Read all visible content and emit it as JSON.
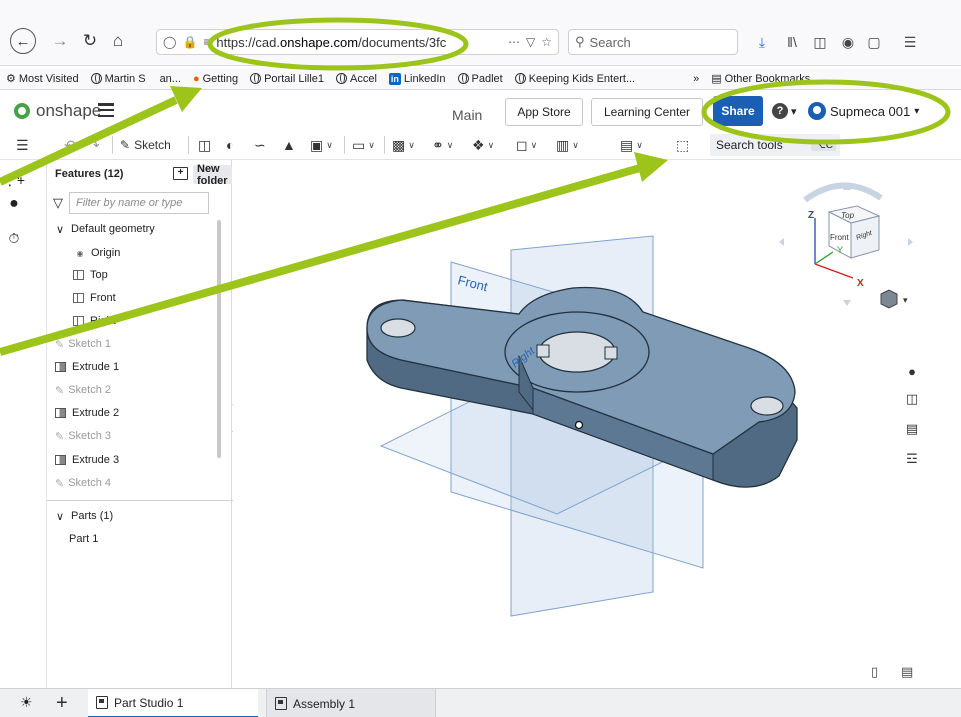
{
  "browser": {
    "url_prefix": "https://cad.",
    "url_domain": "onshape.com",
    "url_path": "/documents/3fc",
    "search_placeholder": "Search",
    "bookmarks": [
      {
        "label": "Most Visited",
        "icon": "gear-icon"
      },
      {
        "label": "Martin S",
        "icon": "globe-icon"
      },
      {
        "label": "an...",
        "icon": "globe-icon"
      },
      {
        "label": "Getting",
        "icon": "firefox-icon"
      },
      {
        "label": "Portail Lille1",
        "icon": "globe-icon"
      },
      {
        "label": "Accel",
        "icon": "globe-icon"
      },
      {
        "label": "LinkedIn",
        "icon": "linkedin-icon"
      },
      {
        "label": "Padlet",
        "icon": "globe-icon"
      },
      {
        "label": "Keeping Kids Entert...",
        "icon": "globe-icon"
      }
    ],
    "other_bookmarks": "Other Bookmarks"
  },
  "onshape": {
    "logo_text": "onshape",
    "workspace": "Main",
    "app_store": "App Store",
    "learning_center": "Learning Center",
    "share": "Share",
    "user": "Supmeca 001"
  },
  "toolbar": {
    "sketch": "Sketch",
    "search_tools": "Search tools",
    "search_shortcut": "⌥C"
  },
  "feature_panel": {
    "title": "Features (12)",
    "new_folder": "New folder",
    "filter_placeholder": "Filter by name or type",
    "default_geometry": "Default geometry",
    "origin": "Origin",
    "planes": [
      "Top",
      "Front",
      "Right"
    ],
    "features": [
      {
        "label": "Sketch 1",
        "kind": "sketch"
      },
      {
        "label": "Extrude 1",
        "kind": "extrude"
      },
      {
        "label": "Sketch 2",
        "kind": "sketch"
      },
      {
        "label": "Extrude 2",
        "kind": "extrude"
      },
      {
        "label": "Sketch 3",
        "kind": "sketch"
      },
      {
        "label": "Extrude 3",
        "kind": "extrude"
      },
      {
        "label": "Sketch 4",
        "kind": "sketch"
      }
    ],
    "parts_header": "Parts (1)",
    "parts": [
      "Part 1"
    ]
  },
  "viewport": {
    "plane_front_label": "Front",
    "plane_right_label": "Right",
    "cube_labels": {
      "top": "Top",
      "front": "Front",
      "right": "Right"
    },
    "axes": {
      "z": "Z",
      "y": "Y",
      "x": "X"
    },
    "part_color": "#6b8aa6",
    "plane_color": "#a9c3e3"
  },
  "tabs": [
    {
      "label": "Part Studio 1",
      "active": true
    },
    {
      "label": "Assembly 1",
      "active": false
    }
  ],
  "annotation_color": "#9cc41a"
}
